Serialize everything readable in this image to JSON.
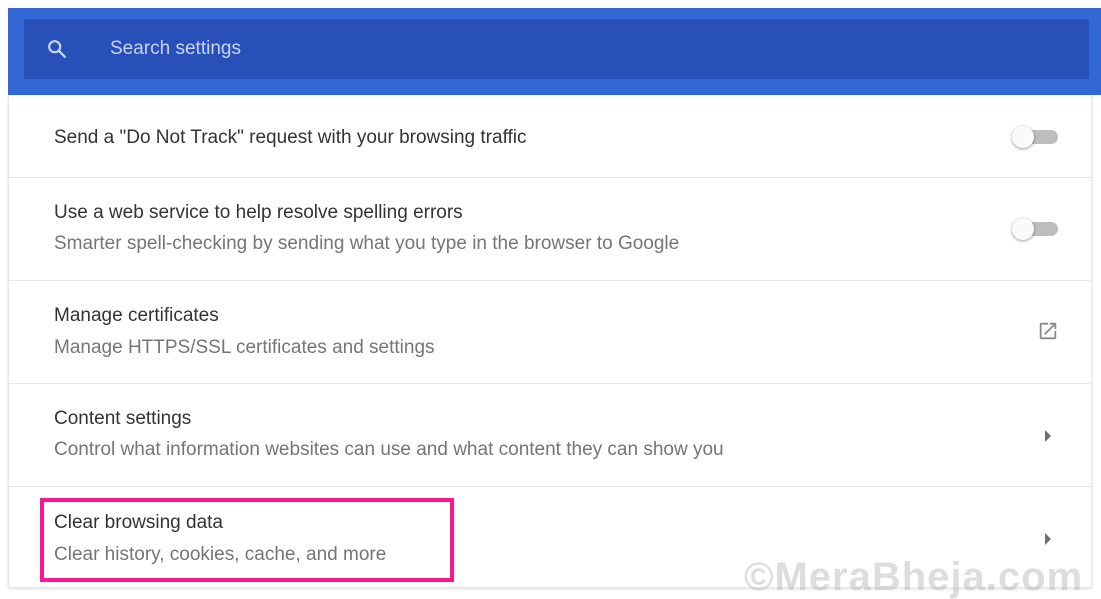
{
  "search": {
    "placeholder": "Search settings",
    "value": ""
  },
  "rows": [
    {
      "title": "Send a \"Do Not Track\" request with your browsing traffic",
      "subtitle": "",
      "control": "toggle",
      "enabled": false
    },
    {
      "title": "Use a web service to help resolve spelling errors",
      "subtitle": "Smarter spell-checking by sending what you type in the browser to Google",
      "control": "toggle",
      "enabled": false
    },
    {
      "title": "Manage certificates",
      "subtitle": "Manage HTTPS/SSL certificates and settings",
      "control": "open-in-new-icon"
    },
    {
      "title": "Content settings",
      "subtitle": "Control what information websites can use and what content they can show you",
      "control": "chevron-right-icon"
    },
    {
      "title": "Clear browsing data",
      "subtitle": "Clear history, cookies, cache, and more",
      "control": "chevron-right-icon",
      "highlighted": true
    }
  ],
  "watermark": "©MeraBheja.com",
  "colors": {
    "header": "#3367d6",
    "search_box": "#2850b8",
    "highlight": "#ff1493",
    "toggle_off_track": "#bdbdbd"
  }
}
